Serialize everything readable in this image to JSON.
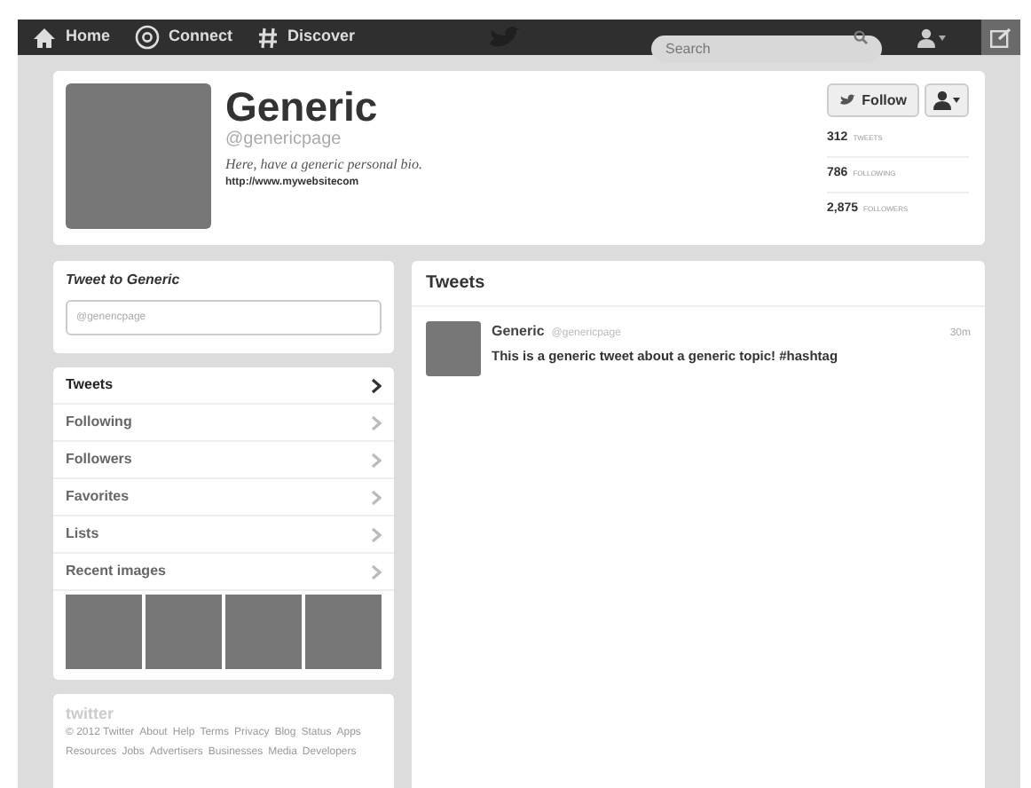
{
  "topbar": {
    "nav": [
      {
        "kind": "home",
        "label": "Home"
      },
      {
        "kind": "connect",
        "label": "Connect"
      },
      {
        "kind": "discover",
        "label": "Discover"
      }
    ],
    "search": {
      "placeholder": "Search"
    }
  },
  "profile": {
    "name": "Generic",
    "handle": "@genericpage",
    "bio": "Here, have a generic personal bio.",
    "url": "http://www.mywebsitecom",
    "follow_button": "Follow",
    "stats": [
      {
        "count": "312",
        "label": "TWEETS"
      },
      {
        "count": "786",
        "label": "FOLLOWING"
      },
      {
        "count": "2,875",
        "label": "FOLLOWERS"
      }
    ]
  },
  "tweet_to": {
    "title": "Tweet to Generic",
    "placeholder": "@genericpage"
  },
  "sidebar": {
    "items": [
      {
        "label": "Tweets",
        "selected": true
      },
      {
        "label": "Following",
        "selected": false
      },
      {
        "label": "Followers",
        "selected": false
      },
      {
        "label": "Favorites",
        "selected": false
      },
      {
        "label": "Lists",
        "selected": false
      },
      {
        "label": "Recent images",
        "selected": false
      }
    ]
  },
  "footer": {
    "logo": "twitter",
    "links": [
      "© 2012 Twitter",
      "About",
      "Help",
      "Terms",
      "Privacy",
      "Blog",
      "Status",
      "Apps",
      "Resources",
      "Jobs",
      "Advertisers",
      "Businesses",
      "Media",
      "Developers"
    ]
  },
  "timeline": {
    "title": "Tweets",
    "tweets": [
      {
        "name": "Generic",
        "handle": "@genericpage",
        "time": "30m",
        "text": "This is a generic tweet about a generic topic! #hashtag"
      }
    ]
  }
}
